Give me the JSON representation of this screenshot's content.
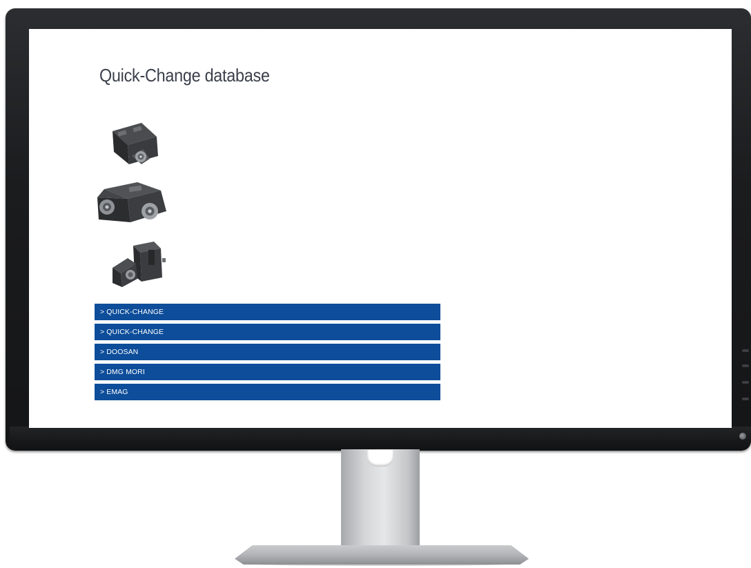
{
  "page": {
    "title": "Quick-Change database"
  },
  "products": [
    {
      "name": "quick-change-holder-straight"
    },
    {
      "name": "quick-change-holder-double"
    },
    {
      "name": "quick-change-holder-angled"
    }
  ],
  "links": [
    {
      "label": "> QUICK-CHANGE"
    },
    {
      "label": "> QUICK-CHANGE"
    },
    {
      "label": "> DOOSAN"
    },
    {
      "label": "> DMG MORI"
    },
    {
      "label": "> EMAG"
    }
  ],
  "colors": {
    "link_background": "#0d4d9a",
    "link_text": "#ffffff",
    "title_text": "#3a3f4a",
    "bezel": "#1b1c1e"
  }
}
